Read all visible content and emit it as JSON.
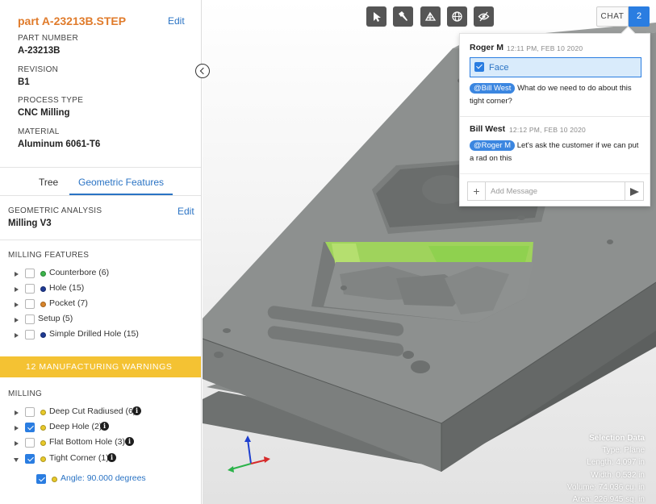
{
  "part": {
    "file_name": "part A-23213B.STEP",
    "edit_label": "Edit",
    "properties": [
      {
        "label": "PART NUMBER",
        "value": "A-23213B"
      },
      {
        "label": "REVISION",
        "value": "B1"
      },
      {
        "label": "PROCESS TYPE",
        "value": "CNC Milling"
      },
      {
        "label": "MATERIAL",
        "value": "Aluminum 6061-T6"
      }
    ]
  },
  "tabs": [
    {
      "label": "Tree",
      "active": false
    },
    {
      "label": "Geometric Features",
      "active": true
    }
  ],
  "analysis": {
    "label": "GEOMETRIC ANALYSIS",
    "value": "Milling V3",
    "edit_label": "Edit"
  },
  "milling_features": {
    "title": "MILLING FEATURES",
    "items": [
      {
        "label": "Counterbore (6)",
        "color": "#3cb44b",
        "checked": false
      },
      {
        "label": "Hole (15)",
        "color": "#1f3a93",
        "checked": false
      },
      {
        "label": "Pocket (7)",
        "color": "#d8842a",
        "checked": false
      },
      {
        "label": "Setup (5)",
        "color": "",
        "checked": false
      },
      {
        "label": "Simple Drilled Hole (15)",
        "color": "#1f3a93",
        "checked": false
      }
    ]
  },
  "warnings": {
    "banner": "12 MANUFACTURING WARNINGS",
    "color": "#f4c233",
    "group_title": "MILLING",
    "items": [
      {
        "label": "Deep Cut Radiused (6)",
        "color": "#e8c92a",
        "checked": false,
        "expanded": false
      },
      {
        "label": "Deep Hole (2)",
        "color": "#e8c92a",
        "checked": true,
        "expanded": false
      },
      {
        "label": "Flat Bottom Hole (3)",
        "color": "#e8c92a",
        "checked": false,
        "expanded": false
      },
      {
        "label": "Tight Corner (1)",
        "color": "#e8c92a",
        "checked": true,
        "expanded": true
      }
    ],
    "sub_item": {
      "label": "Angle: 90.000 degrees",
      "color": "#e8c92a",
      "checked": true
    }
  },
  "toolbar": {
    "icons": [
      "select-icon",
      "hammer-icon",
      "measure-icon",
      "globe-icon",
      "hide-icon"
    ]
  },
  "chat": {
    "button_label": "CHAT",
    "count": "2",
    "messages": [
      {
        "author": "Roger M",
        "time": "12:11 PM, FEB 10 2020",
        "chip": "Face",
        "mention": "@Bill West",
        "text": "What do we need to do about this tight corner?"
      },
      {
        "author": "Bill West",
        "time": "12:12 PM, FEB 10 2020",
        "mention": "@Roger M",
        "text": "Let's ask the customer if we can put a rad on this"
      }
    ],
    "input_placeholder": "Add Message",
    "add_label": "+"
  },
  "selection_data": {
    "title": "Selection Data",
    "type": "Type: Plane",
    "length": "Length: 4.097 in",
    "width": "Width: 0.532 in",
    "volume": "Volume: 74.036 cu. in",
    "area": "Area: 226.945 sq. in"
  },
  "accent_color": "#2a7de1",
  "highlight_color": "#8fd14f"
}
